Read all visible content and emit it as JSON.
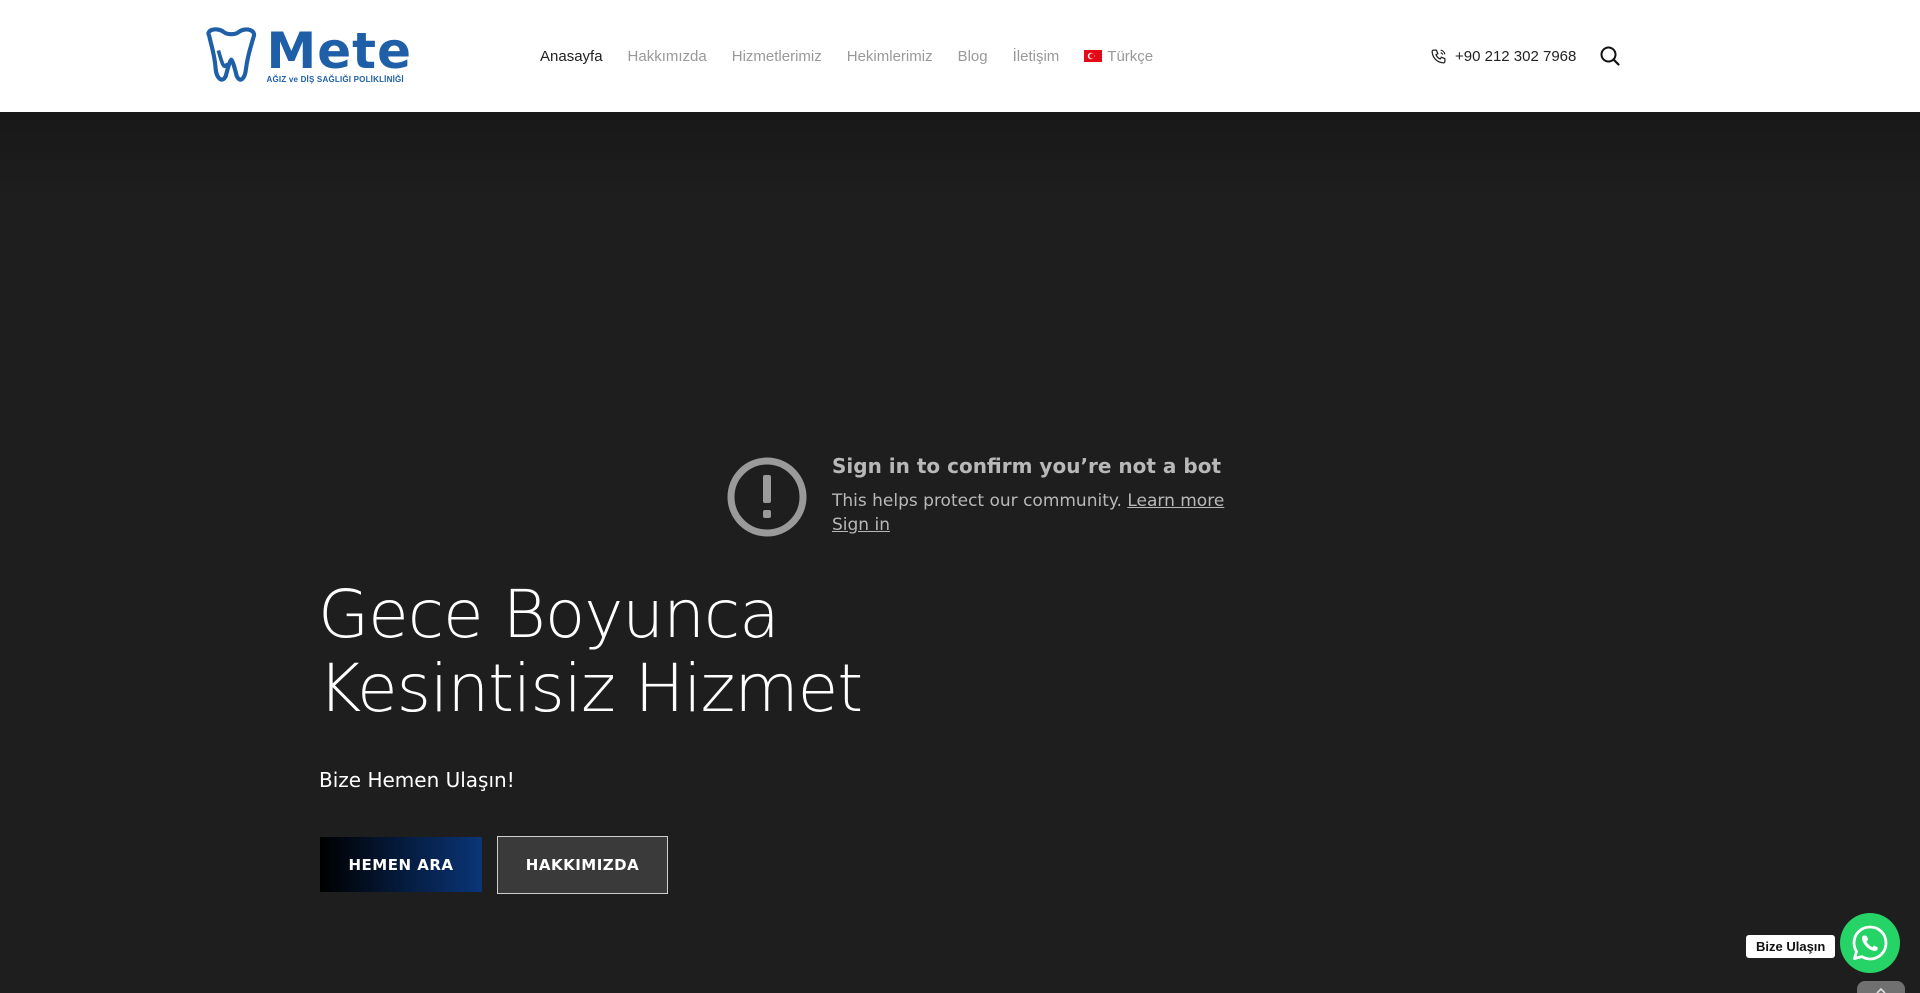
{
  "logo": {
    "word": "Mete",
    "subtitle": "AĞIZ ve DİŞ SAĞLIĞI POLİKLİNİĞİ",
    "icon": "tooth-logo-icon",
    "color": "#1f5fa8"
  },
  "nav": {
    "items": [
      {
        "label": "Anasayfa",
        "active": true
      },
      {
        "label": "Hakkımızda"
      },
      {
        "label": "Hizmetlerimiz"
      },
      {
        "label": "Hekimlerimiz"
      },
      {
        "label": "Blog"
      },
      {
        "label": "İletişim"
      },
      {
        "label": "Türkçe",
        "icon": "turkey-flag-icon"
      }
    ]
  },
  "header": {
    "phone": "+90 212 302 7968",
    "phone_icon": "phone-icon",
    "search_icon": "search-icon"
  },
  "bot_notice": {
    "icon": "exclamation-circle-icon",
    "title": "Sign in to confirm you’re not a bot",
    "description": "This helps protect our community.",
    "learn_more": "Learn more",
    "sign_in": "Sign in"
  },
  "hero": {
    "title_line1": "Gece Boyunca",
    "title_line2": "Kesintisiz Hizmet",
    "subtitle": "Bize Hemen Ulaşın!",
    "primary_button": "HEMEN ARA",
    "secondary_button": "HAKKIMIZDA"
  },
  "whatsapp": {
    "label": "Bize Ulaşın",
    "icon": "whatsapp-icon",
    "color": "#25d366"
  },
  "scroll_top": {
    "icon": "chevron-up-icon"
  }
}
